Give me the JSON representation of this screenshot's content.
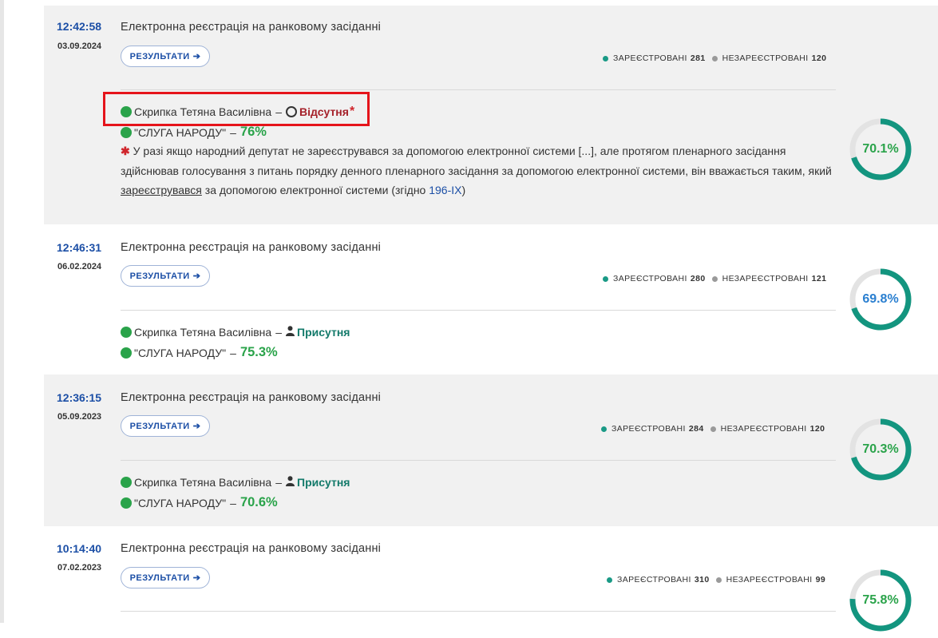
{
  "records": [
    {
      "time": "12:42:58",
      "date": "03.09.2024",
      "title": "Електронна реєстрація на ранковому засіданні",
      "button": "РЕЗУЛЬТАТИ",
      "registered_label": "ЗАРЕЄСТРОВАНІ",
      "registered": "281",
      "unregistered_label": "НЕЗАРЕЄСТРОВАНІ",
      "unregistered": "120",
      "deputy": "Скрипка Тетяна Василівна",
      "dash": "–",
      "status": "Відсутня",
      "status_star": "*",
      "party": "\"СЛУГА НАРОДУ\"",
      "party_pct": "76%",
      "percent": "70.1%",
      "percent_value": 70.1,
      "note_star": "✱",
      "note_text_1": " У разі якщо народний депутат не зареєструвався за допомогою електронної системи [...], але протягом пленарного засідання здійснював голосування з питань порядку денного пленарного засідання за допомогою електронної системи, він вважається таким, який ",
      "note_underline": "зареєструвався",
      "note_text_2": " за допомогою електронної системи (згідно ",
      "note_link": "196-IX",
      "note_text_3": ")"
    },
    {
      "time": "12:46:31",
      "date": "06.02.2024",
      "title": "Електронна реєстрація на ранковому засіданні",
      "button": "РЕЗУЛЬТАТИ",
      "registered_label": "ЗАРЕЄСТРОВАНІ",
      "registered": "280",
      "unregistered_label": "НЕЗАРЕЄСТРОВАНІ",
      "unregistered": "121",
      "deputy": "Скрипка Тетяна Василівна",
      "dash": "–",
      "status": "Присутня",
      "party": "\"СЛУГА НАРОДУ\"",
      "party_pct": "75.3%",
      "percent": "69.8%",
      "percent_value": 69.8
    },
    {
      "time": "12:36:15",
      "date": "05.09.2023",
      "title": "Електронна реєстрація на ранковому засіданні",
      "button": "РЕЗУЛЬТАТИ",
      "registered_label": "ЗАРЕЄСТРОВАНІ",
      "registered": "284",
      "unregistered_label": "НЕЗАРЕЄСТРОВАНІ",
      "unregistered": "120",
      "deputy": "Скрипка Тетяна Василівна",
      "dash": "–",
      "status": "Присутня",
      "party": "\"СЛУГА НАРОДУ\"",
      "party_pct": "70.6%",
      "percent": "70.3%",
      "percent_value": 70.3
    },
    {
      "time": "10:14:40",
      "date": "07.02.2023",
      "title": "Електронна реєстрація на ранковому засіданні",
      "button": "РЕЗУЛЬТАТИ",
      "registered_label": "ЗАРЕЄСТРОВАНІ",
      "registered": "310",
      "unregistered_label": "НЕЗАРЕЄСТРОВАНІ",
      "unregistered": "99",
      "percent": "75.8%",
      "percent_value": 75.8
    }
  ],
  "colors": {
    "time_blue": "#1c4fa6",
    "green": "#2aa34a",
    "ring_teal": "#13957f",
    "absent_red": "#a5212a",
    "present_teal": "#137a6a",
    "highlight_red": "#e5141b"
  }
}
